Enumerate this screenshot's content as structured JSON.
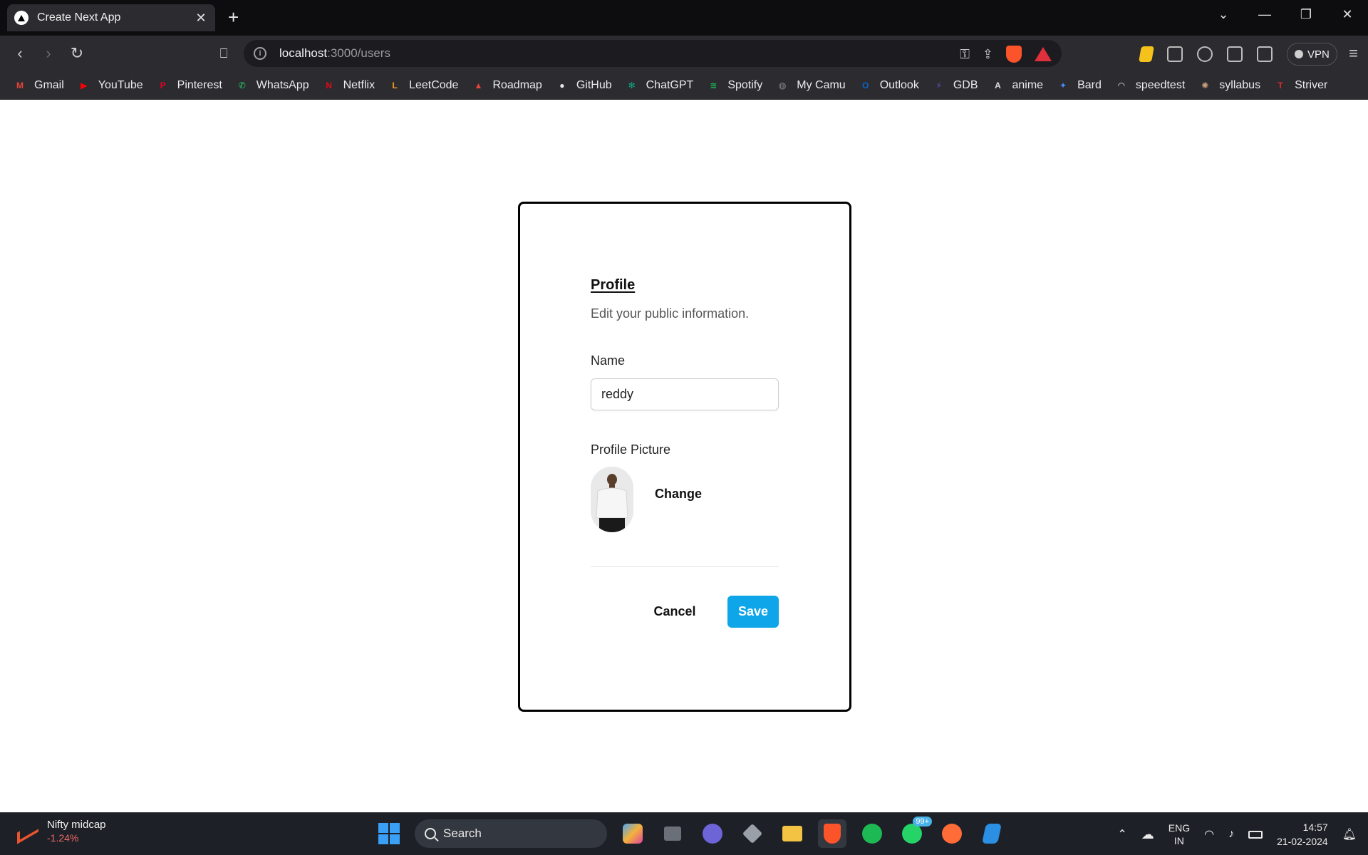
{
  "browser": {
    "tab_title": "Create Next App",
    "new_tab_symbol": "+",
    "url_host": "localhost",
    "url_path": ":3000/users",
    "vpn_label": "VPN",
    "window_controls": [
      "⌄",
      "—",
      "❐",
      "✕"
    ]
  },
  "bookmarks": [
    {
      "label": "Gmail",
      "icon": "gmail-icon",
      "color": "#ea4335",
      "glyph": "M"
    },
    {
      "label": "YouTube",
      "icon": "youtube-icon",
      "color": "#ff0000",
      "glyph": "▶"
    },
    {
      "label": "Pinterest",
      "icon": "pinterest-icon",
      "color": "#e60023",
      "glyph": "P"
    },
    {
      "label": "WhatsApp",
      "icon": "whatsapp-icon",
      "color": "#25d366",
      "glyph": "✆"
    },
    {
      "label": "Netflix",
      "icon": "netflix-icon",
      "color": "#e50914",
      "glyph": "N"
    },
    {
      "label": "LeetCode",
      "icon": "leetcode-icon",
      "color": "#f89f1b",
      "glyph": "L"
    },
    {
      "label": "Roadmap",
      "icon": "roadmap-icon",
      "color": "#e8453c",
      "glyph": "▲"
    },
    {
      "label": "GitHub",
      "icon": "github-icon",
      "color": "#e6e6e6",
      "glyph": "●"
    },
    {
      "label": "ChatGPT",
      "icon": "chatgpt-icon",
      "color": "#10a37f",
      "glyph": "✻"
    },
    {
      "label": "Spotify",
      "icon": "spotify-icon",
      "color": "#1db954",
      "glyph": "≋"
    },
    {
      "label": "My Camu",
      "icon": "globe-icon",
      "color": "#8a8a8a",
      "glyph": "◍"
    },
    {
      "label": "Outlook",
      "icon": "outlook-icon",
      "color": "#0a64c9",
      "glyph": "O"
    },
    {
      "label": "GDB",
      "icon": "gdb-icon",
      "color": "#6f4cc3",
      "glyph": "⚡"
    },
    {
      "label": "anime",
      "icon": "anime-icon",
      "color": "#dcdcdc",
      "glyph": "A"
    },
    {
      "label": "Bard",
      "icon": "bard-icon",
      "color": "#4b8af5",
      "glyph": "✦"
    },
    {
      "label": "speedtest",
      "icon": "speedtest-icon",
      "color": "#e6e6e6",
      "glyph": "◠"
    },
    {
      "label": "syllabus",
      "icon": "syllabus-icon",
      "color": "#c9a27a",
      "glyph": "✺"
    },
    {
      "label": "Striver",
      "icon": "striver-icon",
      "color": "#e02a2a",
      "glyph": "T"
    }
  ],
  "form": {
    "title": "Profile",
    "subtitle": "Edit your public information.",
    "name_label": "Name",
    "name_value": "reddy",
    "picture_label": "Profile Picture",
    "change_label": "Change",
    "cancel_label": "Cancel",
    "save_label": "Save"
  },
  "taskbar": {
    "widget_name": "Nifty midcap",
    "widget_value": "-1.24%",
    "search_label": "Search",
    "whatsapp_badge": "99+",
    "lang_top": "ENG",
    "lang_bottom": "IN",
    "time": "14:57",
    "date": "21-02-2024"
  },
  "colors": {
    "accent": "#0ea5e9",
    "chrome_bg": "#2b2b30",
    "titlebar_bg": "#0d0d10",
    "taskbar_bg": "#1d2026"
  }
}
